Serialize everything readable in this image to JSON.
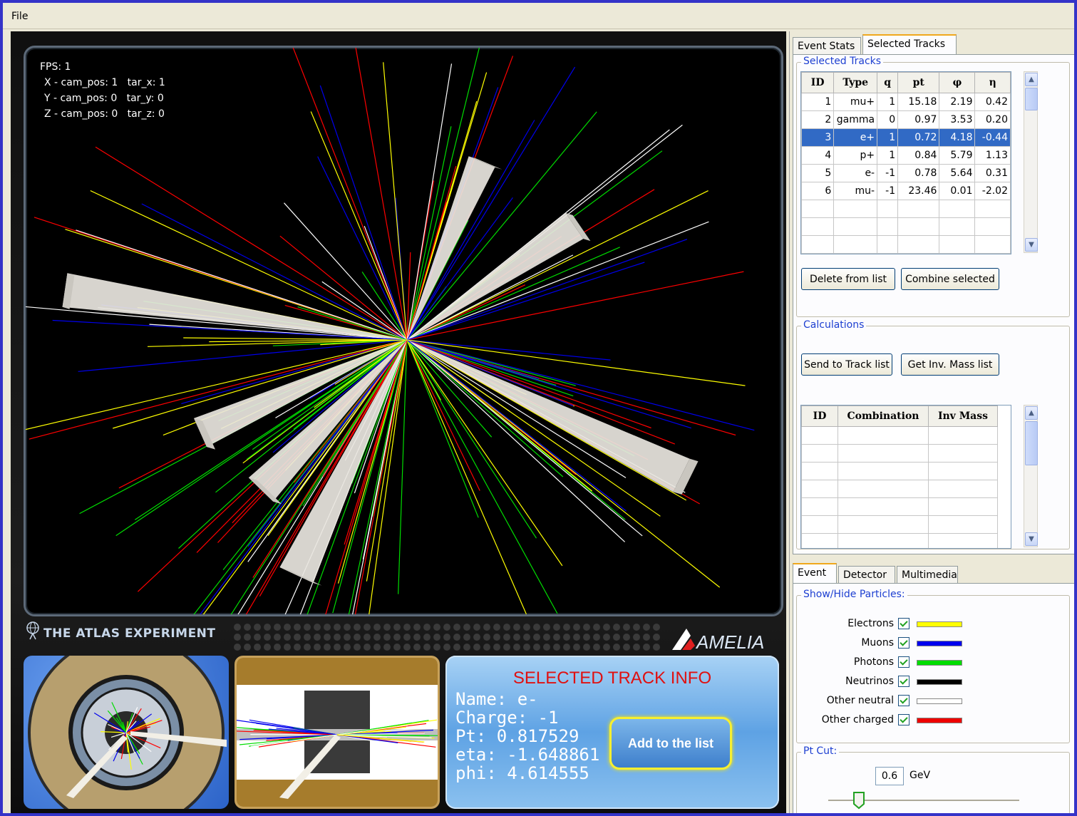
{
  "menu": {
    "file": "File"
  },
  "hud": {
    "fps": "FPS: 1",
    "x_line": "X - cam_pos: 1   tar_x: 1",
    "y_line": "Y - cam_pos: 0   tar_y: 0",
    "z_line": "Z - cam_pos: 0   tar_z: 0"
  },
  "branding": {
    "experiment": "THE ATLAS EXPERIMENT",
    "app": "AMELIA"
  },
  "track_info": {
    "title": "SELECTED TRACK INFO",
    "name": "Name: e-",
    "charge": "Charge: -1",
    "pt": "Pt: 0.817529",
    "eta": "eta: -1.648861",
    "phi": "phi: 4.614555",
    "add_button": "Add to the list"
  },
  "top_tabs": [
    {
      "label": "Event Stats"
    },
    {
      "label": "Selected Tracks"
    }
  ],
  "selected_tracks": {
    "legend": "Selected Tracks",
    "columns": [
      "ID",
      "Type",
      "q",
      "pt",
      "φ",
      "η"
    ],
    "rows": [
      [
        "1",
        "mu+",
        "1",
        "15.18",
        "2.19",
        "0.42"
      ],
      [
        "2",
        "gamma",
        "0",
        "0.97",
        "3.53",
        "0.20"
      ],
      [
        "3",
        "e+",
        "1",
        "0.72",
        "4.18",
        "-0.44"
      ],
      [
        "4",
        "p+",
        "1",
        "0.84",
        "5.79",
        "1.13"
      ],
      [
        "5",
        "e-",
        "-1",
        "0.78",
        "5.64",
        "0.31"
      ],
      [
        "6",
        "mu-",
        "-1",
        "23.46",
        "0.01",
        "-2.02"
      ]
    ],
    "selected_row": 3,
    "delete_button": "Delete from list",
    "combine_button": "Combine selected"
  },
  "calculations": {
    "legend": "Calculations",
    "send_button": "Send to Track list",
    "invmass_button": "Get Inv. Mass list",
    "columns": [
      "ID",
      "Combination",
      "Inv Mass"
    ]
  },
  "bottom_tabs": [
    {
      "label": "Event"
    },
    {
      "label": "Detector"
    },
    {
      "label": "Multimedia"
    }
  ],
  "particles": {
    "legend": "Show/Hide Particles:",
    "items": [
      {
        "label": "Electrons",
        "checked": true,
        "color": "#ffff00"
      },
      {
        "label": "Muons",
        "checked": true,
        "color": "#0000ee"
      },
      {
        "label": "Photons",
        "checked": true,
        "color": "#00dd00"
      },
      {
        "label": "Neutrinos",
        "checked": true,
        "color": "#000000"
      },
      {
        "label": "Other neutral",
        "checked": true,
        "color": "#ffffff"
      },
      {
        "label": "Other charged",
        "checked": true,
        "color": "#ee0000"
      }
    ]
  },
  "pt_cut": {
    "legend": "Pt Cut:",
    "value": "0.6",
    "unit": "GeV"
  }
}
